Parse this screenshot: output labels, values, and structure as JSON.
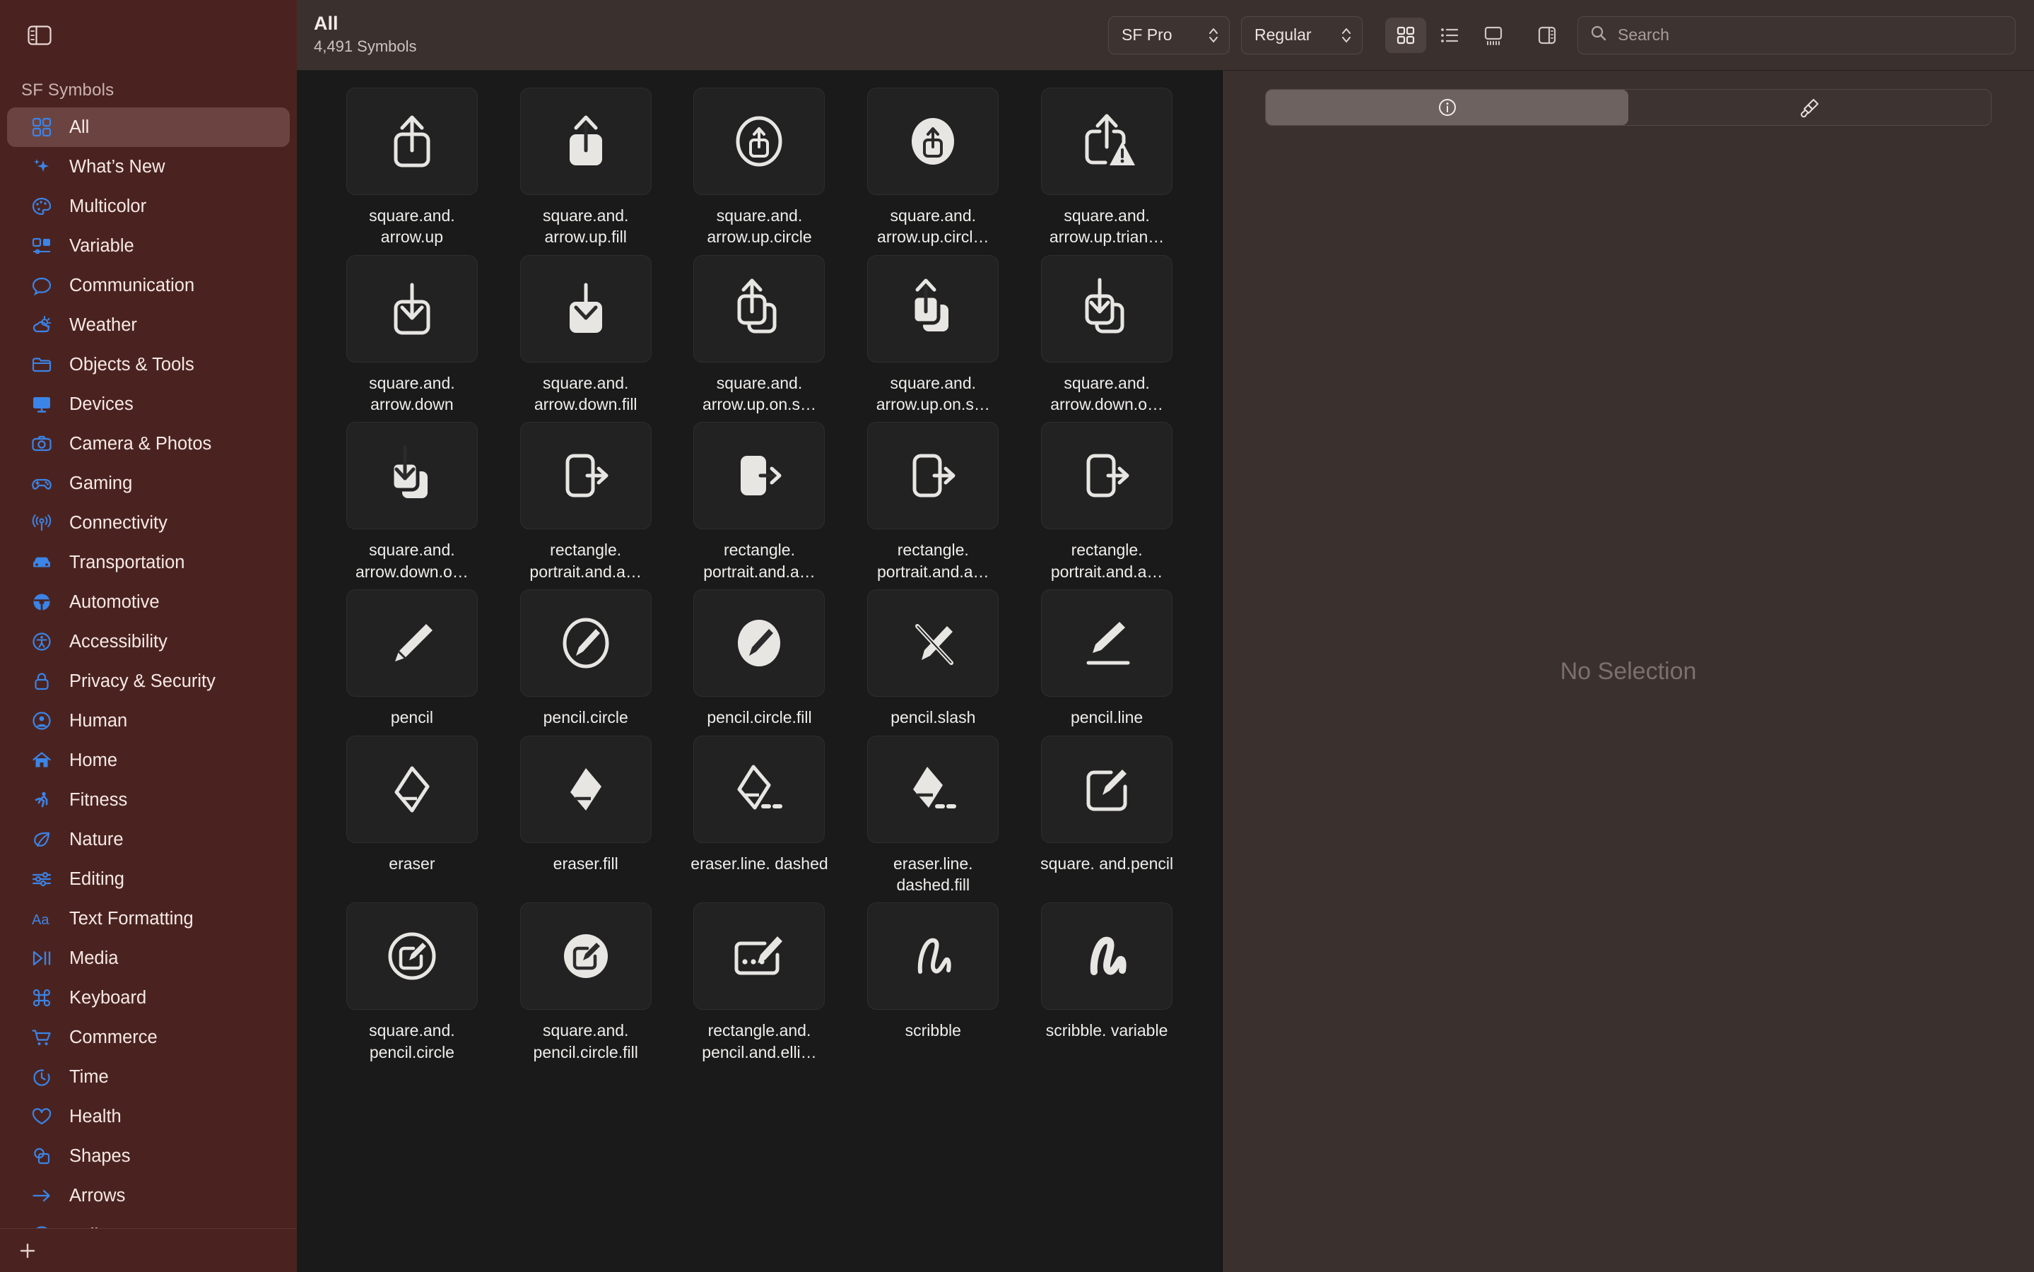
{
  "sidebar": {
    "toggle_icon": "sidebar-toggle-icon",
    "header": "SF Symbols",
    "items": [
      {
        "label": "All",
        "icon": "grid-2x2-icon",
        "selected": true
      },
      {
        "label": "What’s New",
        "icon": "sparkles-icon",
        "selected": false
      },
      {
        "label": "Multicolor",
        "icon": "paintpalette-icon",
        "selected": false
      },
      {
        "label": "Variable",
        "icon": "variable-icon",
        "selected": false
      },
      {
        "label": "Communication",
        "icon": "bubble-icon",
        "selected": false
      },
      {
        "label": "Weather",
        "icon": "cloud-sun-icon",
        "selected": false
      },
      {
        "label": "Objects & Tools",
        "icon": "folder-icon",
        "selected": false
      },
      {
        "label": "Devices",
        "icon": "desktopcomputer-icon",
        "selected": false
      },
      {
        "label": "Camera & Photos",
        "icon": "camera-icon",
        "selected": false
      },
      {
        "label": "Gaming",
        "icon": "gamecontroller-icon",
        "selected": false
      },
      {
        "label": "Connectivity",
        "icon": "antenna-icon",
        "selected": false
      },
      {
        "label": "Transportation",
        "icon": "car-icon",
        "selected": false
      },
      {
        "label": "Automotive",
        "icon": "steeringwheel-icon",
        "selected": false
      },
      {
        "label": "Accessibility",
        "icon": "accessibility-icon",
        "selected": false
      },
      {
        "label": "Privacy & Security",
        "icon": "lock-icon",
        "selected": false
      },
      {
        "label": "Human",
        "icon": "person-circle-icon",
        "selected": false
      },
      {
        "label": "Home",
        "icon": "house-icon",
        "selected": false
      },
      {
        "label": "Fitness",
        "icon": "figure-run-icon",
        "selected": false
      },
      {
        "label": "Nature",
        "icon": "leaf-icon",
        "selected": false
      },
      {
        "label": "Editing",
        "icon": "sliders-icon",
        "selected": false
      },
      {
        "label": "Text Formatting",
        "icon": "textformat-icon",
        "selected": false
      },
      {
        "label": "Media",
        "icon": "play-pause-icon",
        "selected": false
      },
      {
        "label": "Keyboard",
        "icon": "command-icon",
        "selected": false
      },
      {
        "label": "Commerce",
        "icon": "cart-icon",
        "selected": false
      },
      {
        "label": "Time",
        "icon": "timer-icon",
        "selected": false
      },
      {
        "label": "Health",
        "icon": "heart-icon",
        "selected": false
      },
      {
        "label": "Shapes",
        "icon": "shapes-icon",
        "selected": false
      },
      {
        "label": "Arrows",
        "icon": "arrow-right-icon",
        "selected": false
      },
      {
        "label": "Indices",
        "icon": "a-circle-icon",
        "selected": false
      }
    ],
    "add_button": "+",
    "accent_color": "#3b84e8",
    "background_color": "#4a2320",
    "selected_row_color": "#6b4441"
  },
  "toolbar": {
    "title": "All",
    "subtitle": "4,491 Symbols",
    "font_popup": {
      "value": "SF Pro",
      "icon": "chevron-updown-icon"
    },
    "weight_popup": {
      "value": "Regular",
      "icon": "chevron-updown-icon"
    },
    "view_buttons": [
      {
        "name": "grid-view-button",
        "icon": "grid-2x2-icon",
        "active": true
      },
      {
        "name": "list-view-button",
        "icon": "list-bullet-icon",
        "active": false
      },
      {
        "name": "gallery-view-button",
        "icon": "gallery-view-icon",
        "active": false
      }
    ],
    "inspector_toggle": {
      "name": "inspector-toggle-button",
      "icon": "sidebar-right-icon"
    },
    "search": {
      "placeholder": "Search",
      "value": "",
      "icon": "search-icon"
    }
  },
  "inspector": {
    "segments": [
      {
        "name": "info-tab",
        "icon": "info-circle-icon",
        "active": true
      },
      {
        "name": "annotation-tab",
        "icon": "paintbrush-icon",
        "active": false
      }
    ],
    "empty_state": "No Selection",
    "background_color": "#3a302e"
  },
  "grid": {
    "symbols": [
      {
        "name": "square.and.\narrow.up",
        "icon": "square-and-arrow-up"
      },
      {
        "name": "square.and.\narrow.up.fill",
        "icon": "square-and-arrow-up-fill"
      },
      {
        "name": "square.and.\narrow.up.circle",
        "icon": "square-and-arrow-up-circle"
      },
      {
        "name": "square.and.\narrow.up.circl…",
        "icon": "square-and-arrow-up-circle-fill"
      },
      {
        "name": "square.and.\narrow.up.trian…",
        "icon": "square-and-arrow-up-trianglebadge-exclamationmark"
      },
      {
        "name": "square.and.\narrow.down",
        "icon": "square-and-arrow-down"
      },
      {
        "name": "square.and.\narrow.down.fill",
        "icon": "square-and-arrow-down-fill"
      },
      {
        "name": "square.and.\narrow.up.on.s…",
        "icon": "square-and-arrow-up-on-square"
      },
      {
        "name": "square.and.\narrow.up.on.s…",
        "icon": "square-and-arrow-up-on-square-fill"
      },
      {
        "name": "square.and.\narrow.down.o…",
        "icon": "square-and-arrow-down-on-square"
      },
      {
        "name": "square.and.\narrow.down.o…",
        "icon": "square-and-arrow-down-on-square-fill"
      },
      {
        "name": "rectangle.\nportrait.and.a…",
        "icon": "rectangle-portrait-and-arrow-right"
      },
      {
        "name": "rectangle.\nportrait.and.a…",
        "icon": "rectangle-portrait-and-arrow-right-fill"
      },
      {
        "name": "rectangle.\nportrait.and.a…",
        "icon": "rectangle-portrait-and-arrow-forward"
      },
      {
        "name": "rectangle.\nportrait.and.a…",
        "icon": "rectangle-portrait-and-arrow-forward-fill"
      },
      {
        "name": "pencil",
        "icon": "pencil"
      },
      {
        "name": "pencil.circle",
        "icon": "pencil-circle"
      },
      {
        "name": "pencil.circle.fill",
        "icon": "pencil-circle-fill"
      },
      {
        "name": "pencil.slash",
        "icon": "pencil-slash"
      },
      {
        "name": "pencil.line",
        "icon": "pencil-line"
      },
      {
        "name": "eraser",
        "icon": "eraser"
      },
      {
        "name": "eraser.fill",
        "icon": "eraser-fill"
      },
      {
        "name": "eraser.line.\ndashed",
        "icon": "eraser-line-dashed"
      },
      {
        "name": "eraser.line.\ndashed.fill",
        "icon": "eraser-line-dashed-fill"
      },
      {
        "name": "square.\nand.pencil",
        "icon": "square-and-pencil"
      },
      {
        "name": "square.and.\npencil.circle",
        "icon": "square-and-pencil-circle"
      },
      {
        "name": "square.and.\npencil.circle.fill",
        "icon": "square-and-pencil-circle-fill"
      },
      {
        "name": "rectangle.and.\npencil.and.elli…",
        "icon": "rectangle-and-pencil-and-ellipsis"
      },
      {
        "name": "scribble",
        "icon": "scribble"
      },
      {
        "name": "scribble.\nvariable",
        "icon": "scribble-variable"
      }
    ]
  }
}
